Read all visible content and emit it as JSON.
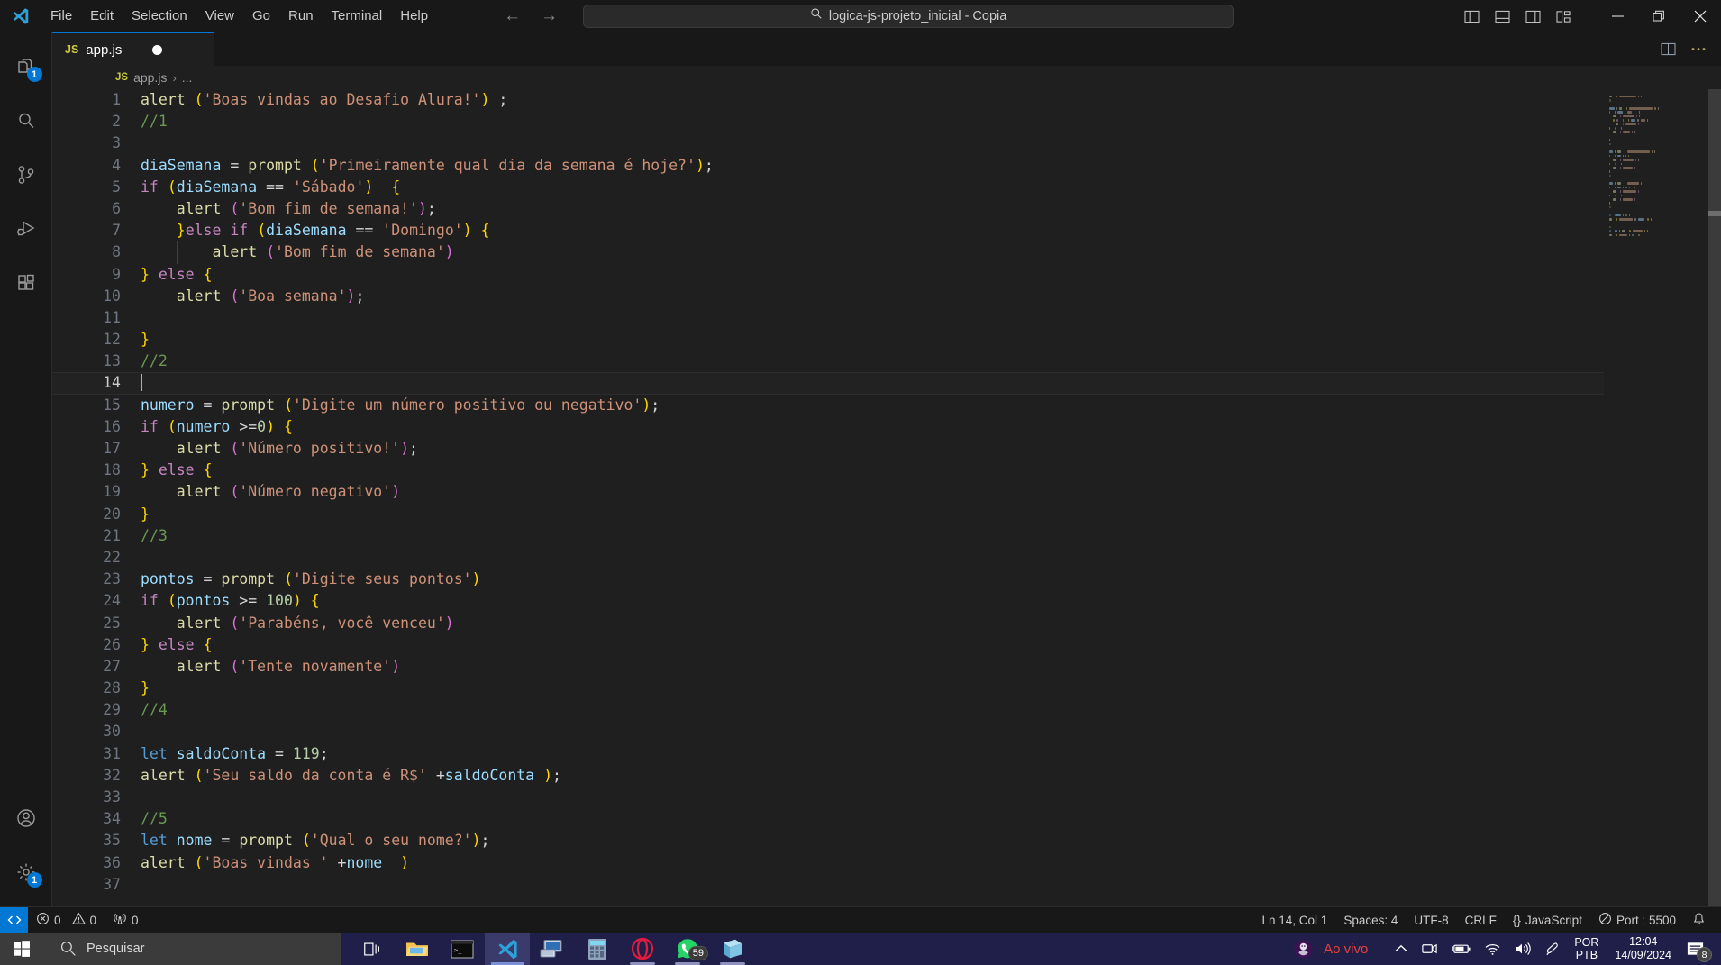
{
  "titlebar": {
    "menus": [
      "File",
      "Edit",
      "Selection",
      "View",
      "Go",
      "Run",
      "Terminal",
      "Help"
    ],
    "search_text": "logica-js-projeto_inicial - Copia",
    "back_glyph": "←",
    "forward_glyph": "→",
    "layout_icons": [
      "toggle-primary-sidebar",
      "toggle-panel",
      "toggle-secondary-sidebar",
      "customize-layout"
    ],
    "window_controls": [
      "minimize",
      "restore",
      "close"
    ]
  },
  "activitybar": {
    "items": [
      {
        "name": "explorer",
        "badge": "1"
      },
      {
        "name": "search",
        "badge": ""
      },
      {
        "name": "source-control",
        "badge": ""
      },
      {
        "name": "run-and-debug",
        "badge": ""
      },
      {
        "name": "extensions",
        "badge": ""
      }
    ],
    "bottom": [
      {
        "name": "accounts",
        "badge": ""
      },
      {
        "name": "manage-settings",
        "badge": "1"
      }
    ]
  },
  "editor": {
    "tab": {
      "lang_badge": "JS",
      "label": "app.js",
      "dirty": true
    },
    "tab_actions": [
      "split-editor",
      "more-actions"
    ],
    "breadcrumb": {
      "lang_badge": "JS",
      "file": "app.js",
      "separator": "›",
      "trail": "..."
    }
  },
  "code": {
    "language": "javascript",
    "cursor_line": 14,
    "lines": [
      {
        "n": 1,
        "tokens": [
          [
            "t-fn",
            "alert"
          ],
          [
            "t-op",
            " "
          ],
          [
            "t-p1",
            "("
          ],
          [
            "t-str",
            "'Boas vindas ao Desafio Alura!'"
          ],
          [
            "t-p1",
            ")"
          ],
          [
            "t-op",
            " ;"
          ]
        ]
      },
      {
        "n": 2,
        "tokens": [
          [
            "t-com",
            "//1"
          ]
        ]
      },
      {
        "n": 3,
        "tokens": []
      },
      {
        "n": 4,
        "tokens": [
          [
            "t-var",
            "diaSemana"
          ],
          [
            "t-op",
            " = "
          ],
          [
            "t-fn",
            "prompt"
          ],
          [
            "t-op",
            " "
          ],
          [
            "t-p1",
            "("
          ],
          [
            "t-str",
            "'Primeiramente qual dia da semana é hoje?'"
          ],
          [
            "t-p1",
            ")"
          ],
          [
            "t-op",
            ";"
          ]
        ]
      },
      {
        "n": 5,
        "tokens": [
          [
            "t-kw",
            "if"
          ],
          [
            "t-op",
            " "
          ],
          [
            "t-p1",
            "("
          ],
          [
            "t-var",
            "diaSemana"
          ],
          [
            "t-op",
            " == "
          ],
          [
            "t-str",
            "'Sábado'"
          ],
          [
            "t-p1",
            ")"
          ],
          [
            "t-op",
            "  "
          ],
          [
            "t-p1",
            "{"
          ]
        ]
      },
      {
        "n": 6,
        "tokens": [
          [
            "t-op",
            "    "
          ],
          [
            "t-fn",
            "alert"
          ],
          [
            "t-op",
            " "
          ],
          [
            "t-p2",
            "("
          ],
          [
            "t-str",
            "'Bom fim de semana!'"
          ],
          [
            "t-p2",
            ")"
          ],
          [
            "t-op",
            ";"
          ]
        ],
        "guides": [
          1
        ]
      },
      {
        "n": 7,
        "tokens": [
          [
            "t-op",
            "    "
          ],
          [
            "t-p1",
            "}"
          ],
          [
            "t-kw",
            "else"
          ],
          [
            "t-op",
            " "
          ],
          [
            "t-kw",
            "if"
          ],
          [
            "t-op",
            " "
          ],
          [
            "t-p1",
            "("
          ],
          [
            "t-var",
            "diaSemana"
          ],
          [
            "t-op",
            " == "
          ],
          [
            "t-str",
            "'Domingo'"
          ],
          [
            "t-p1",
            ")"
          ],
          [
            "t-op",
            " "
          ],
          [
            "t-p1",
            "{"
          ]
        ],
        "guides": [
          1
        ]
      },
      {
        "n": 8,
        "tokens": [
          [
            "t-op",
            "        "
          ],
          [
            "t-fn",
            "alert"
          ],
          [
            "t-op",
            " "
          ],
          [
            "t-p2",
            "("
          ],
          [
            "t-str",
            "'Bom fim de semana'"
          ],
          [
            "t-p2",
            ")"
          ]
        ],
        "guides": [
          1,
          2
        ]
      },
      {
        "n": 9,
        "tokens": [
          [
            "t-p1",
            "}"
          ],
          [
            "t-op",
            " "
          ],
          [
            "t-kw",
            "else"
          ],
          [
            "t-op",
            " "
          ],
          [
            "t-p1",
            "{"
          ]
        ]
      },
      {
        "n": 10,
        "tokens": [
          [
            "t-op",
            "    "
          ],
          [
            "t-fn",
            "alert"
          ],
          [
            "t-op",
            " "
          ],
          [
            "t-p2",
            "("
          ],
          [
            "t-str",
            "'Boa semana'"
          ],
          [
            "t-p2",
            ")"
          ],
          [
            "t-op",
            ";"
          ]
        ],
        "guides": [
          1
        ]
      },
      {
        "n": 11,
        "tokens": [],
        "guides": [
          1
        ]
      },
      {
        "n": 12,
        "tokens": [
          [
            "t-p1",
            "}"
          ]
        ]
      },
      {
        "n": 13,
        "tokens": [
          [
            "t-com",
            "//2"
          ]
        ]
      },
      {
        "n": 14,
        "tokens": [],
        "cursor": true
      },
      {
        "n": 15,
        "tokens": [
          [
            "t-var",
            "numero"
          ],
          [
            "t-op",
            " = "
          ],
          [
            "t-fn",
            "prompt"
          ],
          [
            "t-op",
            " "
          ],
          [
            "t-p1",
            "("
          ],
          [
            "t-str",
            "'Digite um número positivo ou negativo'"
          ],
          [
            "t-p1",
            ")"
          ],
          [
            "t-op",
            ";"
          ]
        ]
      },
      {
        "n": 16,
        "tokens": [
          [
            "t-kw",
            "if"
          ],
          [
            "t-op",
            " "
          ],
          [
            "t-p1",
            "("
          ],
          [
            "t-var",
            "numero"
          ],
          [
            "t-op",
            " >="
          ],
          [
            "t-num",
            "0"
          ],
          [
            "t-p1",
            ")"
          ],
          [
            "t-op",
            " "
          ],
          [
            "t-p1",
            "{"
          ]
        ]
      },
      {
        "n": 17,
        "tokens": [
          [
            "t-op",
            "    "
          ],
          [
            "t-fn",
            "alert"
          ],
          [
            "t-op",
            " "
          ],
          [
            "t-p2",
            "("
          ],
          [
            "t-str",
            "'Número positivo!'"
          ],
          [
            "t-p2",
            ")"
          ],
          [
            "t-op",
            ";"
          ]
        ],
        "guides": [
          1
        ]
      },
      {
        "n": 18,
        "tokens": [
          [
            "t-p1",
            "}"
          ],
          [
            "t-op",
            " "
          ],
          [
            "t-kw",
            "else"
          ],
          [
            "t-op",
            " "
          ],
          [
            "t-p1",
            "{"
          ]
        ]
      },
      {
        "n": 19,
        "tokens": [
          [
            "t-op",
            "    "
          ],
          [
            "t-fn",
            "alert"
          ],
          [
            "t-op",
            " "
          ],
          [
            "t-p2",
            "("
          ],
          [
            "t-str",
            "'Número negativo'"
          ],
          [
            "t-p2",
            ")"
          ]
        ],
        "guides": [
          1
        ]
      },
      {
        "n": 20,
        "tokens": [
          [
            "t-p1",
            "}"
          ]
        ]
      },
      {
        "n": 21,
        "tokens": [
          [
            "t-com",
            "//3"
          ]
        ]
      },
      {
        "n": 22,
        "tokens": []
      },
      {
        "n": 23,
        "tokens": [
          [
            "t-var",
            "pontos"
          ],
          [
            "t-op",
            " = "
          ],
          [
            "t-fn",
            "prompt"
          ],
          [
            "t-op",
            " "
          ],
          [
            "t-p1",
            "("
          ],
          [
            "t-str",
            "'Digite seus pontos'"
          ],
          [
            "t-p1",
            ")"
          ]
        ]
      },
      {
        "n": 24,
        "tokens": [
          [
            "t-kw",
            "if"
          ],
          [
            "t-op",
            " "
          ],
          [
            "t-p1",
            "("
          ],
          [
            "t-var",
            "pontos"
          ],
          [
            "t-op",
            " >= "
          ],
          [
            "t-num",
            "100"
          ],
          [
            "t-p1",
            ")"
          ],
          [
            "t-op",
            " "
          ],
          [
            "t-p1",
            "{"
          ]
        ]
      },
      {
        "n": 25,
        "tokens": [
          [
            "t-op",
            "    "
          ],
          [
            "t-fn",
            "alert"
          ],
          [
            "t-op",
            " "
          ],
          [
            "t-p2",
            "("
          ],
          [
            "t-str",
            "'Parabéns, você venceu'"
          ],
          [
            "t-p2",
            ")"
          ]
        ],
        "guides": [
          1
        ]
      },
      {
        "n": 26,
        "tokens": [
          [
            "t-p1",
            "}"
          ],
          [
            "t-op",
            " "
          ],
          [
            "t-kw",
            "else"
          ],
          [
            "t-op",
            " "
          ],
          [
            "t-p1",
            "{"
          ]
        ]
      },
      {
        "n": 27,
        "tokens": [
          [
            "t-op",
            "    "
          ],
          [
            "t-fn",
            "alert"
          ],
          [
            "t-op",
            " "
          ],
          [
            "t-p2",
            "("
          ],
          [
            "t-str",
            "'Tente novamente'"
          ],
          [
            "t-p2",
            ")"
          ]
        ],
        "guides": [
          1
        ]
      },
      {
        "n": 28,
        "tokens": [
          [
            "t-p1",
            "}"
          ]
        ]
      },
      {
        "n": 29,
        "tokens": [
          [
            "t-com",
            "//4"
          ]
        ]
      },
      {
        "n": 30,
        "tokens": []
      },
      {
        "n": 31,
        "tokens": [
          [
            "t-kw2",
            "let"
          ],
          [
            "t-op",
            " "
          ],
          [
            "t-var",
            "saldoConta"
          ],
          [
            "t-op",
            " = "
          ],
          [
            "t-num",
            "119"
          ],
          [
            "t-op",
            ";"
          ]
        ]
      },
      {
        "n": 32,
        "tokens": [
          [
            "t-fn",
            "alert"
          ],
          [
            "t-op",
            " "
          ],
          [
            "t-p1",
            "("
          ],
          [
            "t-str",
            "'Seu saldo da conta é R$'"
          ],
          [
            "t-op",
            " +"
          ],
          [
            "t-var",
            "saldoConta"
          ],
          [
            "t-op",
            " "
          ],
          [
            "t-p1",
            ")"
          ],
          [
            "t-op",
            ";"
          ]
        ]
      },
      {
        "n": 33,
        "tokens": []
      },
      {
        "n": 34,
        "tokens": [
          [
            "t-com",
            "//5"
          ]
        ]
      },
      {
        "n": 35,
        "tokens": [
          [
            "t-kw2",
            "let"
          ],
          [
            "t-op",
            " "
          ],
          [
            "t-var",
            "nome"
          ],
          [
            "t-op",
            " = "
          ],
          [
            "t-fn",
            "prompt"
          ],
          [
            "t-op",
            " "
          ],
          [
            "t-p1",
            "("
          ],
          [
            "t-str",
            "'Qual o seu nome?'"
          ],
          [
            "t-p1",
            ")"
          ],
          [
            "t-op",
            ";"
          ]
        ]
      },
      {
        "n": 36,
        "tokens": [
          [
            "t-fn",
            "alert"
          ],
          [
            "t-op",
            " "
          ],
          [
            "t-p1",
            "("
          ],
          [
            "t-str",
            "'Boas vindas '"
          ],
          [
            "t-op",
            " +"
          ],
          [
            "t-var",
            "nome"
          ],
          [
            "t-op",
            "  "
          ],
          [
            "t-p1",
            ")"
          ]
        ]
      },
      {
        "n": 37,
        "tokens": []
      }
    ]
  },
  "statusbar": {
    "remote_icon": "remote-window",
    "errors_label": "0",
    "warnings_label": "0",
    "ports_label": "0",
    "right": {
      "position": "Ln 14, Col 1",
      "indentation": "Spaces: 4",
      "encoding": "UTF-8",
      "eol": "CRLF",
      "language": "JavaScript",
      "language_prefix": "{}",
      "live_server": "Port : 5500",
      "bell": "notifications-bell"
    }
  },
  "taskbar": {
    "search_placeholder": "Pesquisar",
    "apps": [
      {
        "name": "task-view",
        "active": false,
        "running": false
      },
      {
        "name": "file-explorer",
        "active": false,
        "running": false
      },
      {
        "name": "terminal",
        "active": false,
        "running": false
      },
      {
        "name": "vscode",
        "active": true,
        "running": false
      },
      {
        "name": "remote-desktop",
        "active": false,
        "running": false
      },
      {
        "name": "calculator",
        "active": false,
        "running": false
      },
      {
        "name": "opera",
        "active": false,
        "running": true
      },
      {
        "name": "whatsapp",
        "active": false,
        "running": true,
        "badge": "59"
      },
      {
        "name": "sticky-notes",
        "active": false,
        "running": true
      }
    ],
    "tray": {
      "premier_league_label": "Ao vivo",
      "icons": [
        "show-hidden-icons",
        "camera",
        "battery-charging",
        "wifi",
        "volume",
        "pen"
      ],
      "lang_line1": "POR",
      "lang_line2": "PTB",
      "time": "12:04",
      "date": "14/09/2024",
      "notification_badge": "8"
    }
  },
  "colors": {
    "accent": "#0078d4",
    "editor_bg": "#1f1f1f",
    "chrome_bg": "#181818",
    "taskbar_bg": "#1f1f4a",
    "live_red": "#e8413a"
  }
}
